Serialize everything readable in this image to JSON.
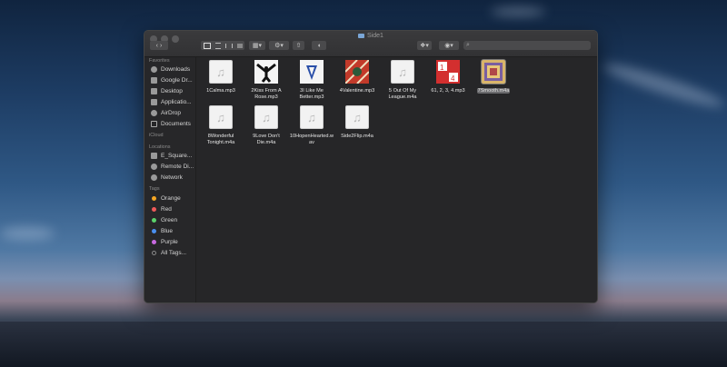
{
  "window": {
    "title": "Side1"
  },
  "toolbar": {
    "back_icon": "chevron-left-icon",
    "forward_icon": "chevron-right-icon",
    "views": [
      "icon-view",
      "list-view",
      "column-view",
      "gallery-view"
    ],
    "search_placeholder": ""
  },
  "sidebar": {
    "favorites_header": "Favorites",
    "favorites": [
      {
        "label": "Downloads",
        "icon": "downloads-icon"
      },
      {
        "label": "Google Dr...",
        "icon": "google-drive-icon"
      },
      {
        "label": "Desktop",
        "icon": "desktop-icon"
      },
      {
        "label": "Applicatio...",
        "icon": "applications-icon"
      },
      {
        "label": "AirDrop",
        "icon": "airdrop-icon"
      },
      {
        "label": "Documents",
        "icon": "documents-icon"
      }
    ],
    "icloud_header": "iCloud",
    "locations_header": "Locations",
    "locations": [
      {
        "label": "E_Square...",
        "icon": "computer-icon"
      },
      {
        "label": "Remote Di...",
        "icon": "remote-disc-icon"
      },
      {
        "label": "Network",
        "icon": "network-icon"
      }
    ],
    "tags_header": "Tags",
    "tags": [
      {
        "label": "Orange",
        "color": "#f5a623"
      },
      {
        "label": "Red",
        "color": "#f05a5a"
      },
      {
        "label": "Green",
        "color": "#5bd26b"
      },
      {
        "label": "Blue",
        "color": "#4a8ff0"
      },
      {
        "label": "Purple",
        "color": "#c86ae0"
      },
      {
        "label": "All Tags...",
        "color": "#8a8a8a"
      }
    ]
  },
  "files": [
    {
      "name": "1Calma.mp3",
      "art": "generic-audio-icon"
    },
    {
      "name": "2Kiss From A Rose.mp3",
      "art": "album-art-dancer"
    },
    {
      "name": "3I Like Me Better.mp3",
      "art": "album-art-triangle"
    },
    {
      "name": "4Valentine.mp3",
      "art": "album-art-red-pattern"
    },
    {
      "name": "5 Out Of My League.m4a",
      "art": "generic-audio-icon"
    },
    {
      "name": "61, 2, 3, 4.mp3",
      "art": "album-art-numbers"
    },
    {
      "name": "7Smooth.m4a",
      "art": "album-art-collage",
      "selected": true
    },
    {
      "name": "8Wonderful Tonight.m4a",
      "art": "generic-audio-icon"
    },
    {
      "name": "9Love Don't Die.m4a",
      "art": "generic-audio-icon"
    },
    {
      "name": "10HopenHearted.wav",
      "art": "generic-audio-icon"
    },
    {
      "name": "Side2Flip.m4a",
      "art": "generic-audio-icon"
    }
  ],
  "colors": {
    "window_bg": "#262628",
    "sidebar_bg": "#272729",
    "selection": "#6b6b6e"
  }
}
